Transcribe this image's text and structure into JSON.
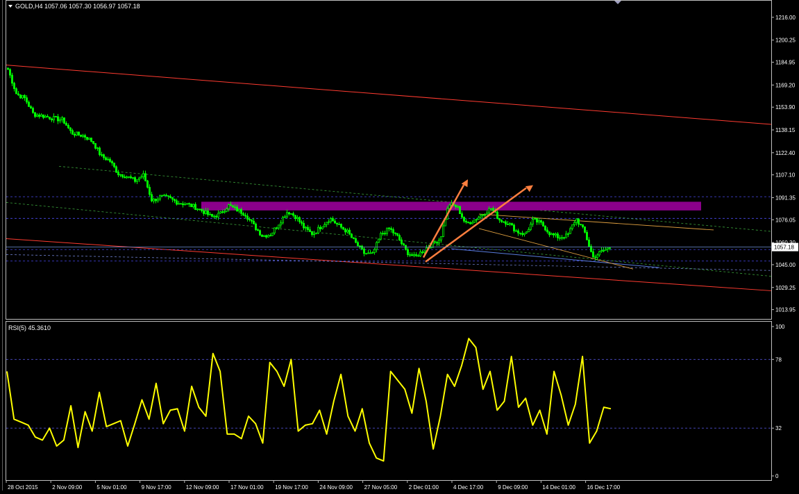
{
  "main_chart": {
    "title": "GOLD,H4  1057.06 1057.30 1056.97 1057.18",
    "price_labels": [
      "1216.00",
      "1200.25",
      "1184.95",
      "1169.20",
      "1153.90",
      "1138.15",
      "1122.40",
      "1107.10",
      "1091.35",
      "1076.05",
      "1060.30",
      "1045.00",
      "1029.25",
      "1013.95"
    ],
    "current_price": "1057.18"
  },
  "rsi": {
    "title": "RSI(5) 45.3610",
    "level_labels": [
      "100",
      "78",
      "32",
      "0"
    ]
  },
  "time_axis": {
    "labels": [
      "28 Oct 2015",
      "2 Nov 09:00",
      "5 Nov 01:00",
      "9 Nov 17:00",
      "12 Nov 09:00",
      "17 Nov 01:00",
      "19 Nov 17:00",
      "24 Nov 09:00",
      "27 Nov 05:00",
      "2 Dec 01:00",
      "4 Dec 17:00",
      "9 Dec 09:00",
      "14 Dec 01:00",
      "16 Dec 17:00"
    ]
  },
  "colors": {
    "background": "#000000",
    "candles": "#00ff00",
    "rsi_line": "#ffff00",
    "channel": "#ff3b30",
    "support_band": "#8b008b",
    "arrows": "#ff7f3f",
    "level_lines": "#4a4af0",
    "trend_dash": "#3aa13a",
    "wedge": "#e0a040"
  },
  "chart_data": [
    {
      "type": "candlestick",
      "title": "GOLD,H4",
      "x_labels": [
        "28 Oct 2015",
        "2 Nov 09:00",
        "5 Nov 01:00",
        "9 Nov 17:00",
        "12 Nov 09:00",
        "17 Nov 01:00",
        "19 Nov 17:00",
        "24 Nov 09:00",
        "27 Nov 05:00",
        "2 Dec 01:00",
        "4 Dec 17:00",
        "9 Dec 09:00",
        "14 Dec 01:00",
        "16 Dec 17:00"
      ],
      "y_ticks": [
        1216.0,
        1200.25,
        1184.95,
        1169.2,
        1153.9,
        1138.15,
        1122.4,
        1107.1,
        1091.35,
        1076.05,
        1060.3,
        1045.0,
        1029.25,
        1013.95
      ],
      "ylim": [
        1008.0,
        1227.0
      ],
      "last": {
        "open": 1057.06,
        "high": 1057.3,
        "low": 1056.97,
        "close": 1057.18
      },
      "close_path": [
        [
          0,
          1180
        ],
        [
          2,
          1163
        ],
        [
          4,
          1160
        ],
        [
          6,
          1149
        ],
        [
          8,
          1148
        ],
        [
          11,
          1146
        ],
        [
          13,
          1145
        ],
        [
          15,
          1136
        ],
        [
          18,
          1134
        ],
        [
          20,
          1130
        ],
        [
          22,
          1120
        ],
        [
          24,
          1117
        ],
        [
          26,
          1108
        ],
        [
          28,
          1106
        ],
        [
          30,
          1103
        ],
        [
          32,
          1107
        ],
        [
          34,
          1089
        ],
        [
          36,
          1092
        ],
        [
          38,
          1091
        ],
        [
          40,
          1088
        ],
        [
          42,
          1087
        ],
        [
          44,
          1085
        ],
        [
          46,
          1082
        ],
        [
          48,
          1078
        ],
        [
          50,
          1080
        ],
        [
          52,
          1086
        ],
        [
          54,
          1083
        ],
        [
          56,
          1080
        ],
        [
          58,
          1072
        ],
        [
          60,
          1065
        ],
        [
          62,
          1066
        ],
        [
          64,
          1074
        ],
        [
          66,
          1082
        ],
        [
          68,
          1078
        ],
        [
          70,
          1070
        ],
        [
          72,
          1066
        ],
        [
          74,
          1072
        ],
        [
          76,
          1077
        ],
        [
          78,
          1072
        ],
        [
          80,
          1068
        ],
        [
          82,
          1060
        ],
        [
          84,
          1053
        ],
        [
          86,
          1052
        ],
        [
          88,
          1066
        ],
        [
          90,
          1070
        ],
        [
          92,
          1064
        ],
        [
          94,
          1054
        ],
        [
          96,
          1050
        ],
        [
          98,
          1055
        ],
        [
          100,
          1059
        ],
        [
          102,
          1063
        ],
        [
          104,
          1087
        ],
        [
          106,
          1085
        ],
        [
          108,
          1073
        ],
        [
          110,
          1076
        ],
        [
          112,
          1080
        ],
        [
          114,
          1084
        ],
        [
          116,
          1076
        ],
        [
          118,
          1074
        ],
        [
          120,
          1068
        ],
        [
          122,
          1066
        ],
        [
          124,
          1076
        ],
        [
          126,
          1073
        ],
        [
          128,
          1066
        ],
        [
          130,
          1064
        ],
        [
          132,
          1065
        ],
        [
          134,
          1077
        ],
        [
          136,
          1068
        ],
        [
          138,
          1050
        ],
        [
          140,
          1054
        ],
        [
          142,
          1057
        ]
      ]
    },
    {
      "type": "line",
      "title": "RSI(5)",
      "value_label": 45.361,
      "y_ticks": [
        100,
        78,
        32,
        0
      ],
      "ylim": [
        0,
        100
      ],
      "series": [
        {
          "values": [
            70,
            38,
            36,
            34,
            26,
            24,
            32,
            20,
            24,
            47,
            19,
            43,
            30,
            56,
            33,
            35,
            37,
            20,
            35,
            51,
            38,
            62,
            35,
            44,
            45,
            30,
            60,
            46,
            40,
            82,
            70,
            28,
            28,
            25,
            40,
            35,
            22,
            76,
            70,
            60,
            78,
            30,
            34,
            35,
            44,
            28,
            50,
            68,
            40,
            30,
            45,
            22,
            12,
            10,
            70,
            64,
            58,
            42,
            72,
            50,
            18,
            40,
            68,
            60,
            74,
            92,
            86,
            58,
            70,
            44,
            50,
            80,
            46,
            52,
            34,
            44,
            28,
            70,
            54,
            34,
            48,
            80,
            22,
            30,
            46,
            45
          ]
        }
      ]
    }
  ]
}
